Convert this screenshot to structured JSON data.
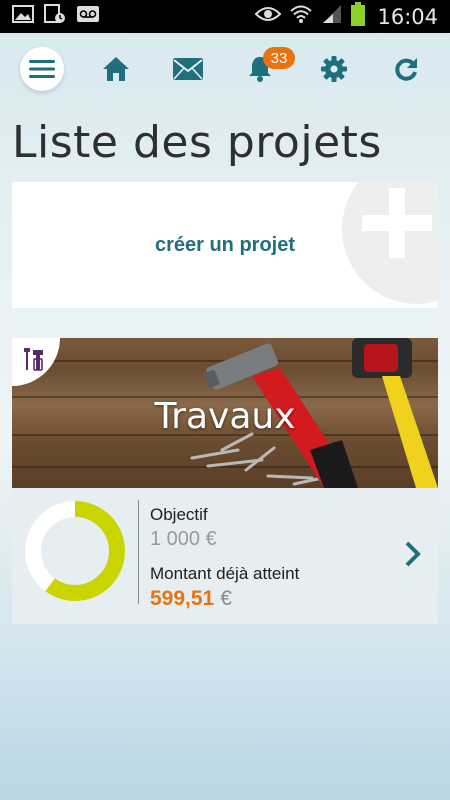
{
  "statusbar": {
    "time": "16:04",
    "icons": [
      "image-icon",
      "calendar-icon",
      "voicemail-icon",
      "eye-icon",
      "wifi-icon",
      "signal-icon",
      "battery-icon"
    ]
  },
  "toolbar": {
    "icons": [
      "menu-icon",
      "home-icon",
      "mail-icon",
      "bell-icon",
      "gear-icon",
      "refresh-icon"
    ],
    "notification_count": "33",
    "accent_color": "#1f6f7d",
    "badge_color": "#e8730f"
  },
  "page": {
    "title": "Liste des projets"
  },
  "create_card": {
    "label": "créer un projet"
  },
  "project": {
    "name": "Travaux",
    "objective_label": "Objectif",
    "objective_value": "1 000 €",
    "reached_label": "Montant déjà atteint",
    "reached_value": "599,51",
    "reached_currency": "€",
    "progress_fraction": 0.6,
    "progress_color": "#c9d400"
  }
}
